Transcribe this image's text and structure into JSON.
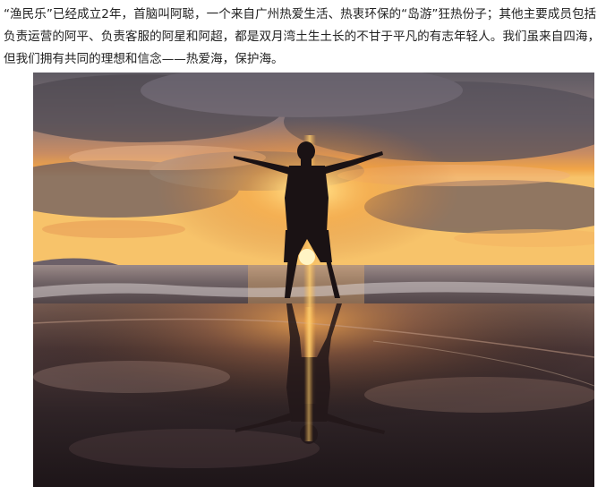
{
  "article": {
    "paragraph": "“渔民乐”已经成立2年，首脑叫阿聪，一个来自广州热爱生活、热衷环保的“岛游”狂热份子；其他主要成员包括负责运营的阿平、负责客服的阿星和阿超，都是双月湾土生土长的不甘于平凡的有志年轻人。我们虽来自四海，但我们拥有共同的理想和信念——热爱海，保护海。"
  },
  "photo": {
    "subject": "silhouette of a man with arms outstretched on a beach at sunset, reflected in wet sand",
    "colors": {
      "sky_top": "#6f6a72",
      "sky_glow": "#f2a24a",
      "sun": "#fff3b0",
      "sea": "#7a6a6c",
      "sand_dark": "#2a2022",
      "silhouette": "#1a1214"
    }
  }
}
